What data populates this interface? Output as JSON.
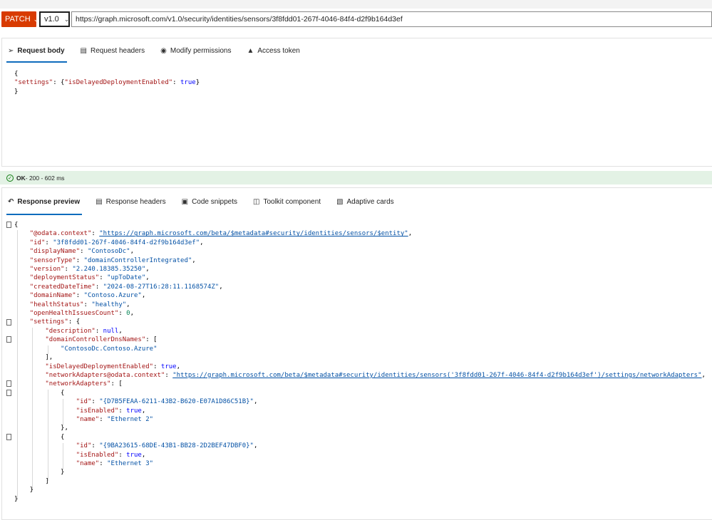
{
  "request": {
    "method": "PATCH",
    "version": "v1.0",
    "url": "https://graph.microsoft.com/v1.0/security/identities/sensors/3f8fdd01-267f-4046-84f4-d2f9b164d3ef"
  },
  "request_tabs": [
    {
      "label": "Request body",
      "icon": "send-icon"
    },
    {
      "label": "Request headers",
      "icon": "document-icon"
    },
    {
      "label": "Modify permissions",
      "icon": "shield-icon"
    },
    {
      "label": "Access token",
      "icon": "lock-icon"
    }
  ],
  "request_body": {
    "open": "{",
    "key": "\"settings\"",
    "value_prefix": ": {",
    "inner_key": "\"isDelayedDeploymentEnabled\"",
    "inner_sep": ": ",
    "inner_value": "true",
    "value_suffix": "}",
    "close": "}"
  },
  "status": {
    "ok": "OK",
    "detail": " - 200 - 602 ms"
  },
  "response_tabs": [
    {
      "label": "Response preview",
      "icon": "arrow-back-icon"
    },
    {
      "label": "Response headers",
      "icon": "document-icon"
    },
    {
      "label": "Code snippets",
      "icon": "clipboard-icon"
    },
    {
      "label": "Toolkit component",
      "icon": "toolkit-icon"
    },
    {
      "label": "Adaptive cards",
      "icon": "card-icon"
    }
  ],
  "response": {
    "odata_context_key": "\"@odata.context\"",
    "odata_context_value": "\"https://graph.microsoft.com/beta/$metadata#security/identities/sensors/$entity\"",
    "id_key": "\"id\"",
    "id_value": "\"3f8fdd01-267f-4046-84f4-d2f9b164d3ef\"",
    "displayName_key": "\"displayName\"",
    "displayName_value": "\"ContosoDc\"",
    "sensorType_key": "\"sensorType\"",
    "sensorType_value": "\"domainControllerIntegrated\"",
    "version_key": "\"version\"",
    "version_value": "\"2.240.18385.35250\"",
    "deploymentStatus_key": "\"deploymentStatus\"",
    "deploymentStatus_value": "\"upToDate\"",
    "createdDateTime_key": "\"createdDateTime\"",
    "createdDateTime_value": "\"2024-08-27T16:28:11.1168574Z\"",
    "domainName_key": "\"domainName\"",
    "domainName_value": "\"Contoso.Azure\"",
    "healthStatus_key": "\"healthStatus\"",
    "healthStatus_value": "\"healthy\"",
    "openHealthIssuesCount_key": "\"openHealthIssuesCount\"",
    "openHealthIssuesCount_value": "0",
    "settings_key": "\"settings\"",
    "description_key": "\"description\"",
    "description_value": "null",
    "domainControllerDnsNames_key": "\"domainControllerDnsNames\"",
    "domainControllerDnsNames_item": "\"ContosoDc.Contoso.Azure\"",
    "isDelayedDeploymentEnabled_key": "\"isDelayedDeploymentEnabled\"",
    "isDelayedDeploymentEnabled_value": "true",
    "networkAdapters_context_key": "\"networkAdapters@odata.context\"",
    "networkAdapters_context_value": "\"https://graph.microsoft.com/beta/$metadata#security/identities/sensors('3f8fdd01-267f-4046-84f4-d2f9b164d3ef')/settings/networkAdapters\"",
    "networkAdapters_key": "\"networkAdapters\"",
    "adapters": [
      {
        "id_key": "\"id\"",
        "id_value": "\"{D7B5FEAA-6211-43B2-B620-E07A1D86C51B}\"",
        "isEnabled_key": "\"isEnabled\"",
        "isEnabled_value": "true",
        "name_key": "\"name\"",
        "name_value": "\"Ethernet 2\""
      },
      {
        "id_key": "\"id\"",
        "id_value": "\"{9BA23615-68DE-43B1-BB28-2D2BEF47DBF0}\"",
        "isEnabled_key": "\"isEnabled\"",
        "isEnabled_value": "true",
        "name_key": "\"name\"",
        "name_value": "\"Ethernet 3\""
      }
    ]
  },
  "colors": {
    "method_bg": "#d83b01",
    "active_tab_underline": "#0f6cbd",
    "status_bg": "#e3f2e5",
    "json_key": "#a31515",
    "json_string": "#0451a5",
    "json_boolean": "#0000ff",
    "json_number": "#098658"
  }
}
